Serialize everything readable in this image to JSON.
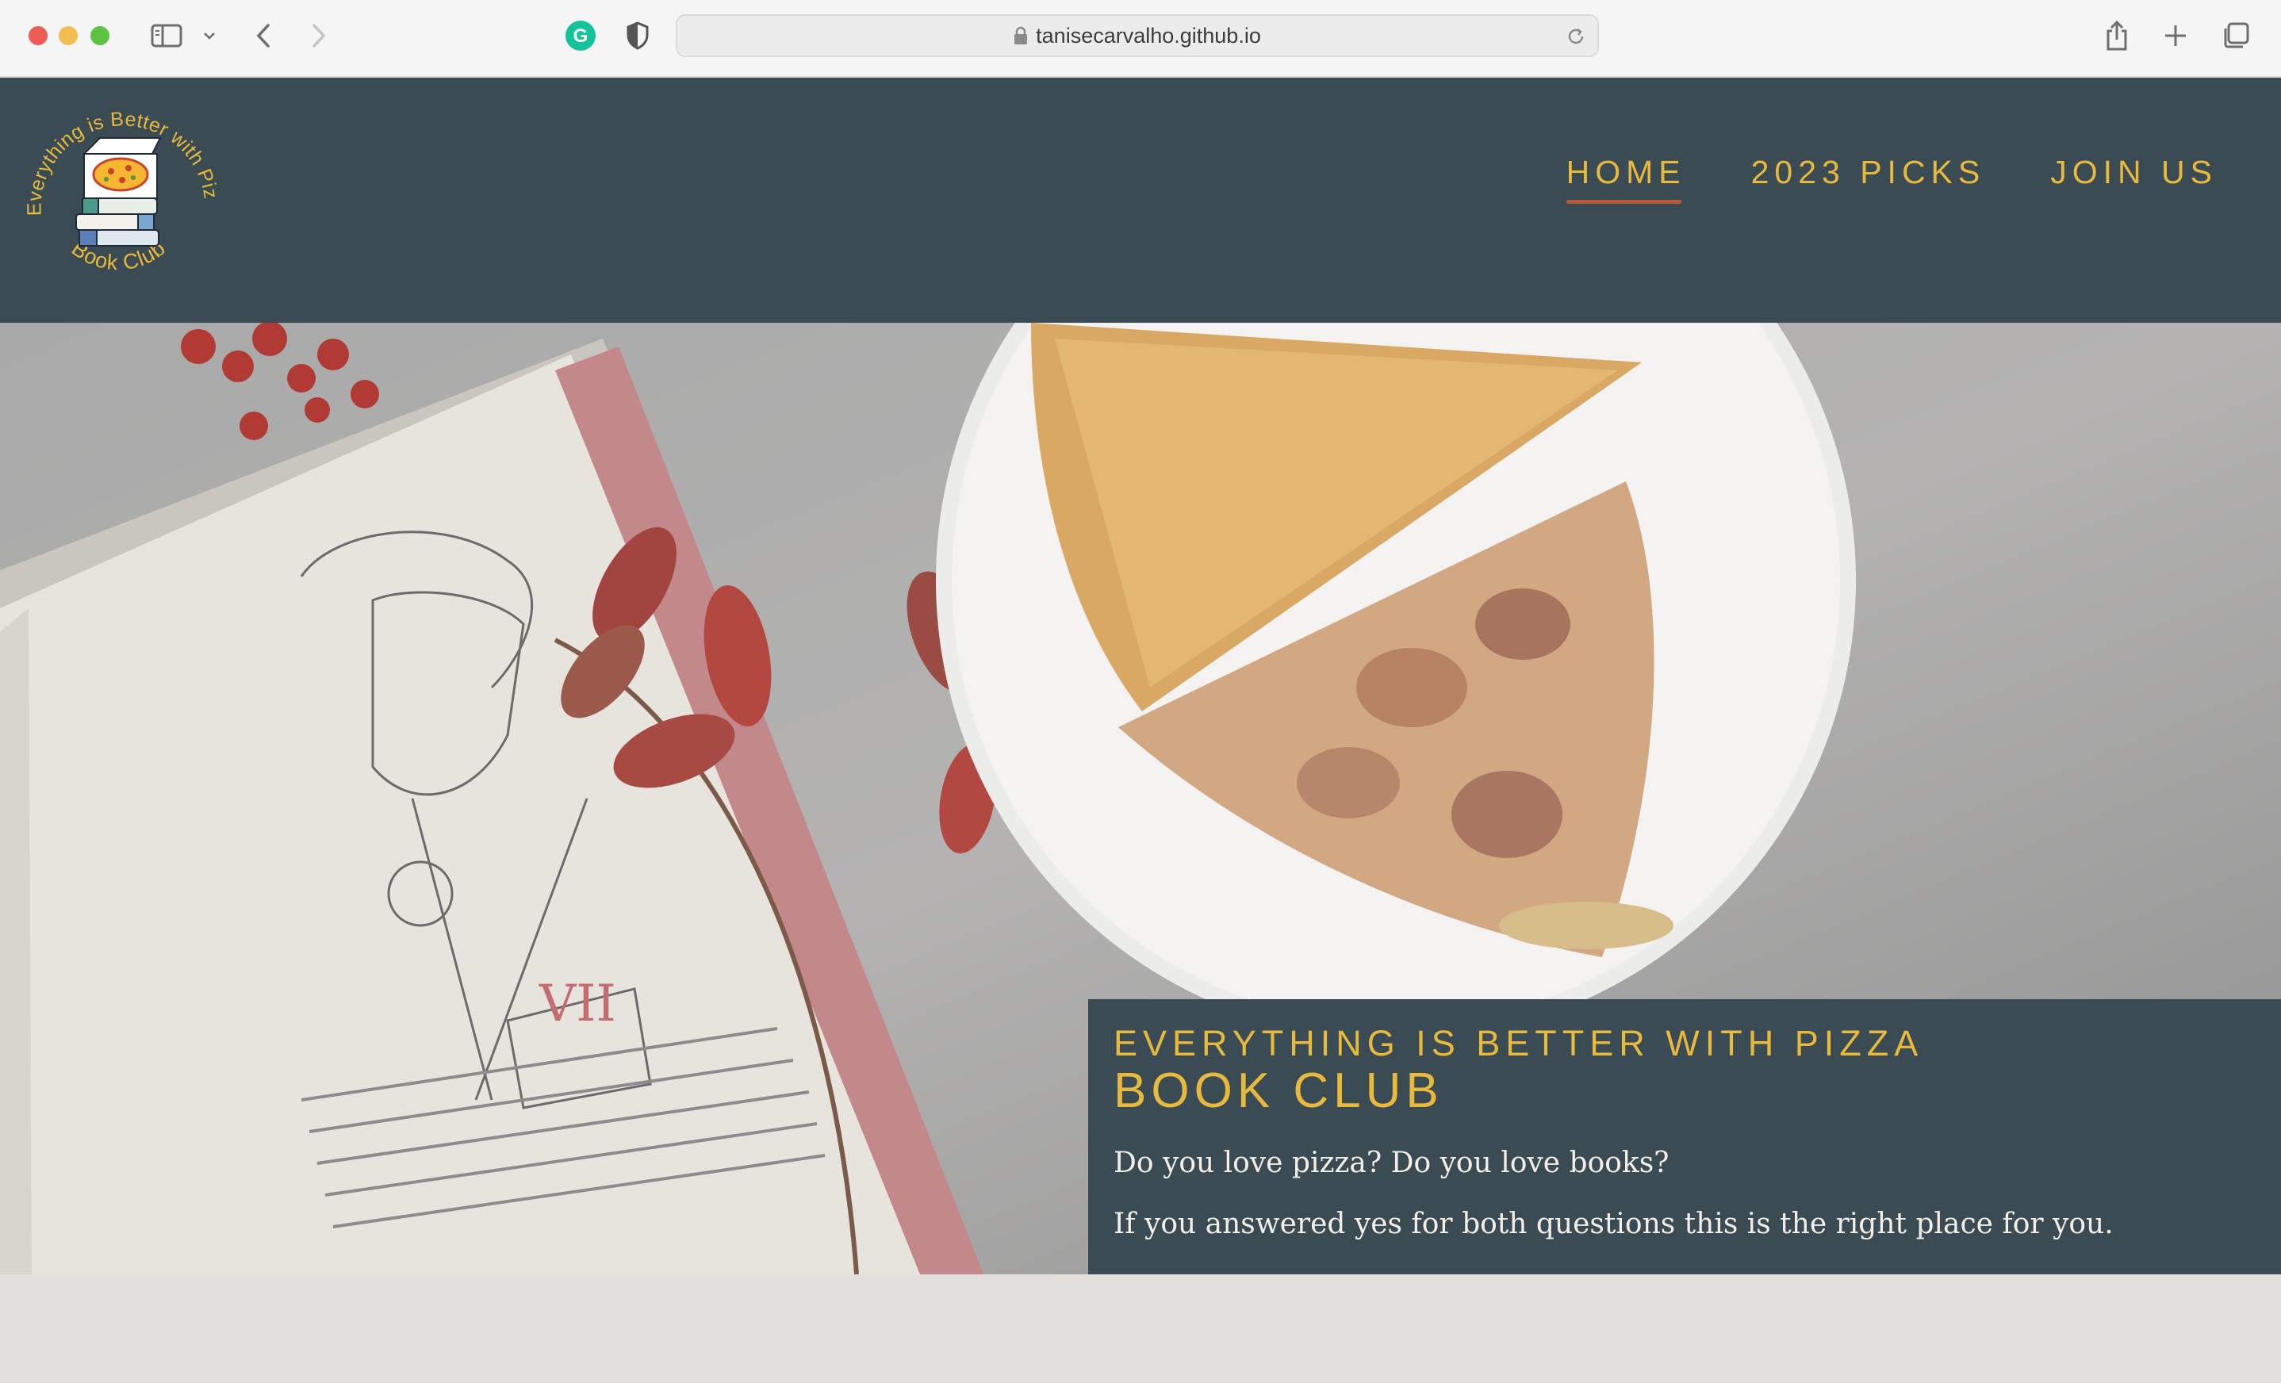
{
  "browser": {
    "url": "tanisecarvalho.github.io",
    "icons": [
      "sidebar-icon",
      "chevron-down-icon",
      "back-icon",
      "forward-icon",
      "grammarly-icon",
      "shield-icon",
      "lock-icon",
      "reload-icon",
      "share-icon",
      "plus-icon",
      "tabs-overview-icon"
    ]
  },
  "header": {
    "logo": {
      "arc_text": "Everything is Better with Pizza",
      "bottom_text": "Book Club"
    },
    "nav": [
      {
        "label": "HOME",
        "active": true
      },
      {
        "label": "2023 PICKS",
        "active": false
      },
      {
        "label": "JOIN US",
        "active": false
      }
    ]
  },
  "hero": {
    "tagline": "EVERYTHING IS BETTER WITH PIZZA",
    "title": "BOOK CLUB",
    "paragraph1": "Do you love pizza? Do you love books?",
    "paragraph2": "If you answered yes for both questions this is the right place for you.",
    "image_label": "VII"
  },
  "colors": {
    "header_bg": "#3a4b54",
    "accent_gold": "#e7b93c",
    "active_underline": "#b95a33",
    "page_bg": "#e4e0de"
  }
}
